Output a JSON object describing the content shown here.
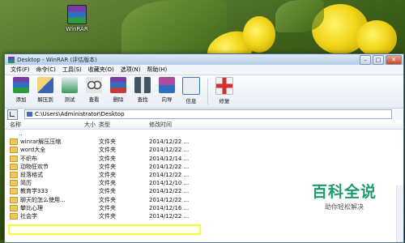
{
  "desktop": {
    "icon_label": "WinRAR"
  },
  "window": {
    "title": "Desktop - WinRAR (评估版本)",
    "controls": [
      "–",
      "□",
      "✕"
    ]
  },
  "menu": [
    "文件(F)",
    "命令(C)",
    "工具(S)",
    "收藏夹(O)",
    "选项(N)",
    "帮助(H)"
  ],
  "toolbar": [
    {
      "label": "添加",
      "icon": "add-archive-icon",
      "color": "#7a3da8"
    },
    {
      "label": "解压到",
      "icon": "extract-icon",
      "color": "#3b62b5"
    },
    {
      "label": "测试",
      "icon": "test-icon",
      "color": "#3a9a55"
    },
    {
      "label": "查看",
      "icon": "view-icon",
      "color": "#888888"
    },
    {
      "label": "删除",
      "icon": "delete-icon",
      "color": "#c33b3b"
    },
    {
      "label": "查找",
      "icon": "find-icon",
      "color": "#445566"
    },
    {
      "label": "向导",
      "icon": "wizard-icon",
      "color": "#b04a9a"
    },
    {
      "label": "信息",
      "icon": "info-icon",
      "color": "#3a76c2"
    },
    {
      "label": "修复",
      "icon": "repair-icon",
      "color": "#d03030"
    }
  ],
  "address": {
    "path": "C:\\Users\\Administrator\\Desktop"
  },
  "columns": {
    "name": "名称",
    "size": "大小",
    "type": "类型",
    "modified": "修改时间"
  },
  "rows": [
    {
      "name": "..",
      "type": "",
      "modified": "",
      "updir": true
    },
    {
      "name": "winrar解压压缩",
      "type": "文件夹",
      "modified": "2014/12/22 ..."
    },
    {
      "name": "word大全",
      "type": "文件夹",
      "modified": "2014/12/22 ..."
    },
    {
      "name": "不织布",
      "type": "文件夹",
      "modified": "2014/12/14 ..."
    },
    {
      "name": "动物狂欢节",
      "type": "文件夹",
      "modified": "2014/12/22 ..."
    },
    {
      "name": "段落格式",
      "type": "文件夹",
      "modified": "2014/12/22 ..."
    },
    {
      "name": "简历",
      "type": "文件夹",
      "modified": "2014/12/10 ..."
    },
    {
      "name": "教育学333",
      "type": "文件夹",
      "modified": "2014/12/22 ..."
    },
    {
      "name": "聊天的怎么使用...",
      "type": "文件夹",
      "modified": "2014/12/22 ..."
    },
    {
      "name": "攀比心理",
      "type": "文件夹",
      "modified": "2014/12/16 ..."
    },
    {
      "name": "社会学",
      "type": "文件夹",
      "modified": "2014/12/22 ..."
    }
  ],
  "watermark": {
    "title": "百科全说",
    "subtitle": "助你轻松解决"
  }
}
